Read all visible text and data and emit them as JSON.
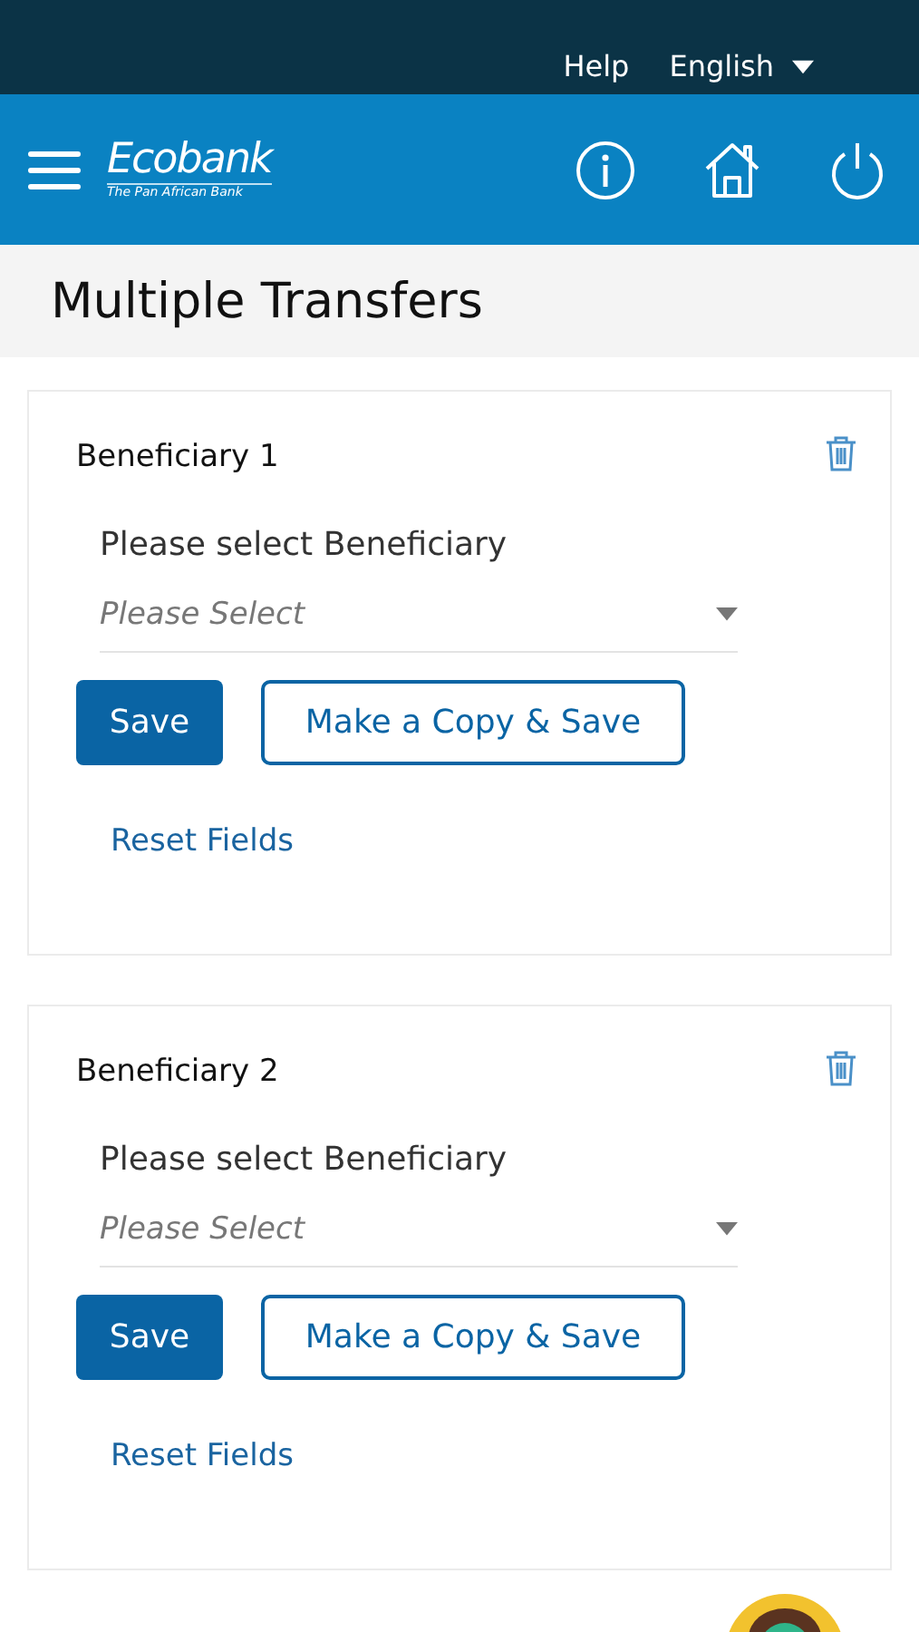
{
  "top_bar": {
    "help": "Help",
    "language": "English"
  },
  "header": {
    "logo_name": "Ecobank",
    "logo_tagline": "The Pan African Bank"
  },
  "page_title": "Multiple Transfers",
  "beneficiaries": [
    {
      "title": "Beneficiary 1",
      "field_label": "Please select Beneficiary",
      "placeholder": "Please Select",
      "save": "Save",
      "copy_save": "Make a Copy & Save",
      "reset": "Reset Fields"
    },
    {
      "title": "Beneficiary 2",
      "field_label": "Please select Beneficiary",
      "placeholder": "Please Select",
      "save": "Save",
      "copy_save": "Make a Copy & Save",
      "reset": "Reset Fields"
    }
  ]
}
